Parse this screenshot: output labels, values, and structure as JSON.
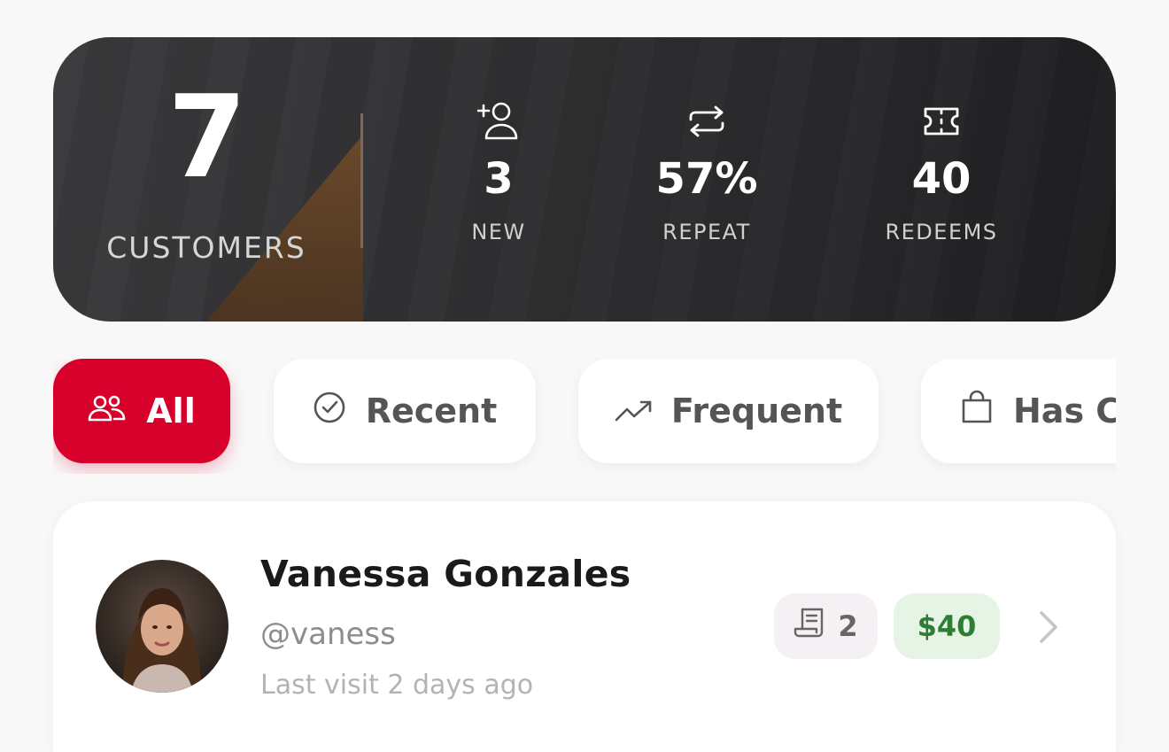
{
  "stats": {
    "customers_count": "7",
    "customers_label": "CUSTOMERS",
    "new": {
      "icon": "user-plus-icon",
      "value": "3",
      "label": "NEW"
    },
    "repeat": {
      "icon": "repeat-icon",
      "value": "57%",
      "label": "REPEAT"
    },
    "redeems": {
      "icon": "ticket-icon",
      "value": "40",
      "label": "REDEEMS"
    }
  },
  "filters": [
    {
      "icon": "users-icon",
      "label": "All",
      "active": true
    },
    {
      "icon": "check-circle-icon",
      "label": "Recent",
      "active": false
    },
    {
      "icon": "trending-up-icon",
      "label": "Frequent",
      "active": false
    },
    {
      "icon": "shopping-bag-icon",
      "label": "Has C",
      "active": false
    }
  ],
  "customer": {
    "name": "Vanessa Gonzales",
    "handle": "@vaness",
    "last_visit": "Last visit 2 days ago",
    "orders_icon": "receipt-icon",
    "orders_count": "2",
    "spend": "$40"
  },
  "colors": {
    "accent": "#d6002a",
    "card_dark": "#2f2f31",
    "spend_text": "#2e7d32",
    "spend_bg": "#e6f4e6"
  }
}
